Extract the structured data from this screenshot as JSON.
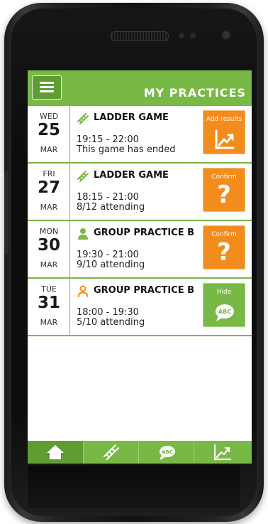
{
  "header": {
    "title": "MY PRACTICES"
  },
  "practices": [
    {
      "dow": "WED",
      "day": "25",
      "month": "MAR",
      "type_icon": "ladder-icon",
      "title": "LADDER GAME",
      "time": "19:15 - 22:00",
      "status": "This game has ended",
      "action": {
        "label": "Add results",
        "icon": "chart-icon",
        "color": "#f28c1c"
      }
    },
    {
      "dow": "FRI",
      "day": "27",
      "month": "MAR",
      "type_icon": "ladder-icon",
      "title": "LADDER GAME",
      "time": "18:15 - 21:00",
      "status": "8/12 attending",
      "action": {
        "label": "Confirm",
        "icon": "question-icon",
        "symbol": "?",
        "color": "#f28c1c"
      }
    },
    {
      "dow": "MON",
      "day": "30",
      "month": "MAR",
      "type_icon": "person-filled-icon",
      "title": "GROUP PRACTICE B",
      "time": "19:30 - 21:00",
      "status": "9/10 attending",
      "action": {
        "label": "Confirm",
        "icon": "question-icon",
        "symbol": "?",
        "color": "#f28c1c"
      }
    },
    {
      "dow": "TUE",
      "day": "31",
      "month": "MAR",
      "type_icon": "person-outline-icon",
      "title": "GROUP PRACTICE B",
      "time": "18:00 - 19:30",
      "status": "5/10 attending",
      "action": {
        "label": "Hide",
        "icon": "abc-bubble-icon",
        "icon_text": "ABC",
        "color": "#78b845"
      }
    }
  ],
  "bottom_nav": [
    {
      "icon": "home-icon",
      "active": true
    },
    {
      "icon": "ladder-icon",
      "active": false
    },
    {
      "icon": "abc-bubble-icon",
      "icon_text": "ABC",
      "active": false
    },
    {
      "icon": "chart-icon",
      "active": false
    }
  ],
  "colors": {
    "brand_green": "#78b845",
    "dark_green": "#5f9d33",
    "accent_orange": "#f28c1c"
  }
}
